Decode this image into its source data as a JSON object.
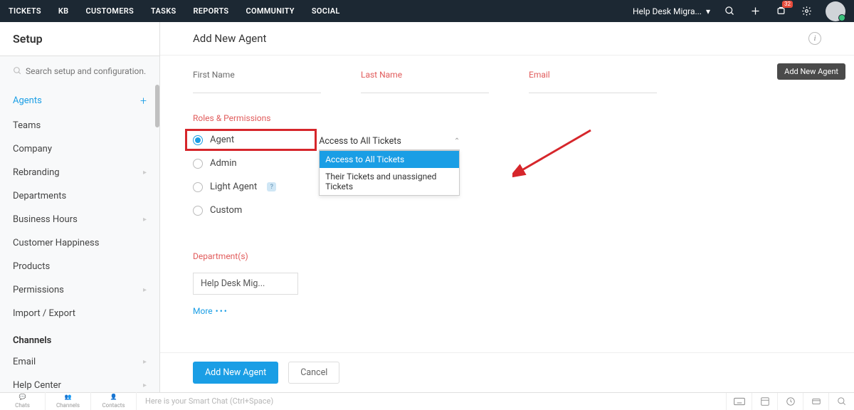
{
  "topnav": {
    "items": [
      "TICKETS",
      "KB",
      "CUSTOMERS",
      "TASKS",
      "REPORTS",
      "COMMUNITY",
      "SOCIAL"
    ],
    "org_label": "Help Desk Migra...",
    "notif_badge": "32"
  },
  "sidebar": {
    "title": "Setup",
    "search_placeholder": "Search setup and configuration...",
    "items": [
      {
        "label": "Agents",
        "active": true,
        "plus": true
      },
      {
        "label": "Teams"
      },
      {
        "label": "Company"
      },
      {
        "label": "Rebranding",
        "chev": true
      },
      {
        "label": "Departments"
      },
      {
        "label": "Business Hours",
        "chev": true
      },
      {
        "label": "Customer Happiness"
      },
      {
        "label": "Products"
      },
      {
        "label": "Permissions",
        "chev": true
      },
      {
        "label": "Import / Export"
      }
    ],
    "section2_title": "Channels",
    "section2_items": [
      {
        "label": "Email",
        "chev": true
      },
      {
        "label": "Help Center",
        "chev": true
      }
    ]
  },
  "page": {
    "title": "Add New Agent",
    "tooltip": "Add New Agent",
    "fields": {
      "first_name": "First Name",
      "last_name": "Last Name",
      "email": "Email"
    },
    "roles_label": "Roles & Permissions",
    "roles": [
      "Agent",
      "Admin",
      "Light Agent",
      "Custom"
    ],
    "perm_selected": "Access to All Tickets",
    "perm_options": [
      "Access to All Tickets",
      "Their Tickets and unassigned Tickets"
    ],
    "dept_label": "Department(s)",
    "dept_value": "Help Desk Mig...",
    "more": "More",
    "submit": "Add New Agent",
    "cancel": "Cancel"
  },
  "statusbar": {
    "items": [
      "Chats",
      "Channels",
      "Contacts"
    ],
    "smartchat": "Here is your Smart Chat (Ctrl+Space)"
  }
}
